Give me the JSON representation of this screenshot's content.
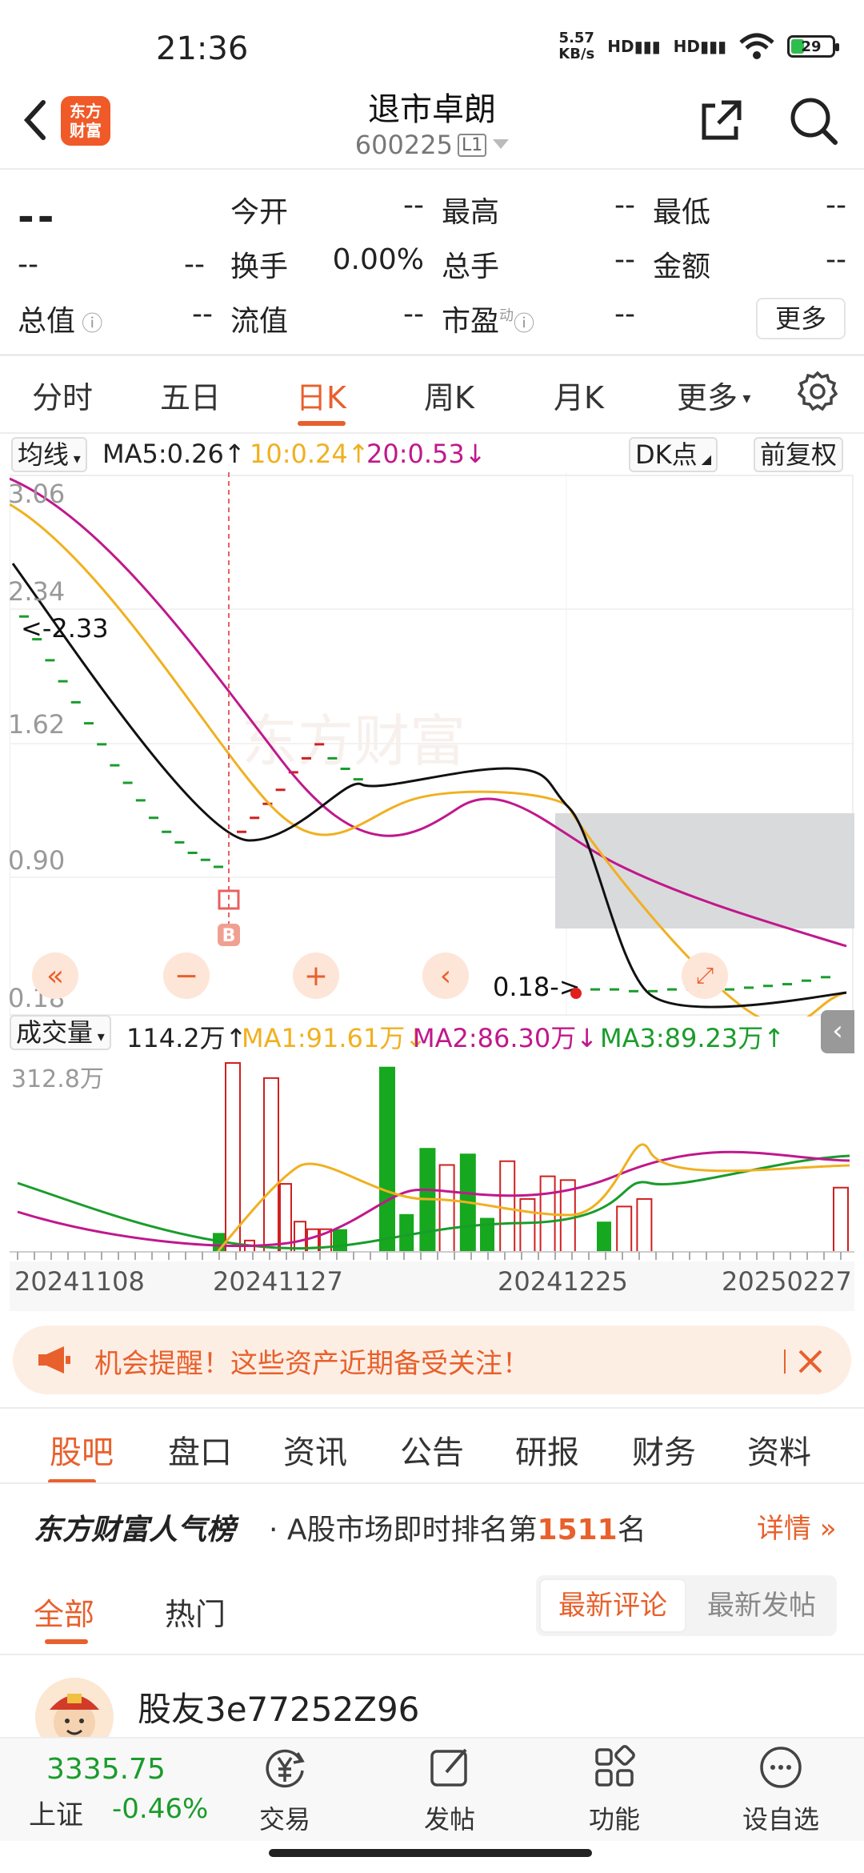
{
  "status": {
    "time": "21:36",
    "net_speed_value": "5.57",
    "net_speed_unit": "KB/s",
    "battery": "29",
    "signal1": "HD",
    "signal2": "HD"
  },
  "header": {
    "logo_text": "东方\n财富",
    "title": "退市卓朗",
    "code": "600225",
    "level": "L1"
  },
  "quote": {
    "price": "--",
    "change": "--",
    "change_pct": "--",
    "fields": [
      {
        "label": "今开",
        "value": "--"
      },
      {
        "label": "最高",
        "value": "--"
      },
      {
        "label": "最低",
        "value": "--"
      },
      {
        "label": "换手",
        "value": "0.00%"
      },
      {
        "label": "总手",
        "value": "--"
      },
      {
        "label": "金额",
        "value": "--"
      },
      {
        "label": "总值",
        "value": "--"
      },
      {
        "label": "流值",
        "value": "--"
      },
      {
        "label": "市盈",
        "value": "--"
      }
    ],
    "pe_superscript": "动",
    "more_label": "更多"
  },
  "kline_tabs": [
    "分时",
    "五日",
    "日K",
    "周K",
    "月K",
    "更多"
  ],
  "kline_active": "日K",
  "ma_bar": {
    "selector": "均线",
    "ma5": "MA5:0.26",
    "ma10": "10:0.24",
    "ma20": "20:0.53",
    "dk_label": "DK点",
    "adjust_label": "前复权",
    "colors": {
      "ma5": "#111111",
      "ma10": "#f0b020",
      "ma20": "#c0188c"
    }
  },
  "chart_data": {
    "type": "candlestick",
    "y_ticks": [
      "3.06",
      "2.34",
      "1.62",
      "0.90",
      "0.18"
    ],
    "ylim": [
      0.18,
      3.06
    ],
    "x_ticks": [
      "20241108",
      "20241127",
      "20241225",
      "20250227"
    ],
    "annotations": {
      "high_label": "<-2.33",
      "low_label": "0.18->",
      "buy_marker": "B"
    },
    "price_bars": [
      2.33,
      2.2,
      2.08,
      1.96,
      1.84,
      1.72,
      1.6,
      1.48,
      1.38,
      1.28,
      1.18,
      1.1,
      1.04,
      0.98,
      0.94,
      0.9,
      1.1,
      1.18,
      1.26,
      1.34,
      1.44,
      1.52,
      1.6,
      1.52,
      1.46,
      1.4,
      0.18,
      0.2,
      0.2,
      0.19,
      0.19,
      0.2,
      0.2,
      0.19,
      0.2,
      0.21,
      0.22,
      0.23,
      0.25,
      0.27
    ],
    "volume": {
      "header_label": "成交量",
      "current": "114.2万",
      "ma1": "MA1:91.61万",
      "ma2": "MA2:86.30万",
      "ma3": "MA3:89.23万",
      "ymax_label": "312.8万",
      "colors": {
        "ma1": "#f0b020",
        "ma2": "#c0188c",
        "ma3": "#1a9c2c"
      }
    }
  },
  "banner": {
    "text": "机会提醒！这些资产近期备受关注！"
  },
  "bottom_tabs": [
    "股吧",
    "盘口",
    "资讯",
    "公告",
    "研报",
    "财务",
    "资料"
  ],
  "rank": {
    "title": "东方财富人气榜",
    "prefix": "· A股市场即时排名第",
    "number": "1511",
    "suffix": "名",
    "detail": "详情"
  },
  "sub_tabs": [
    "全部",
    "热门"
  ],
  "sort": {
    "active": "最新评论",
    "inactive": "最新发帖"
  },
  "post": {
    "username": "股友3e77252Z96"
  },
  "bottom_nav": {
    "index_value": "3335.75",
    "index_name": "上证",
    "index_change": "-0.46%",
    "items": [
      "交易",
      "发帖",
      "功能",
      "设自选"
    ]
  }
}
